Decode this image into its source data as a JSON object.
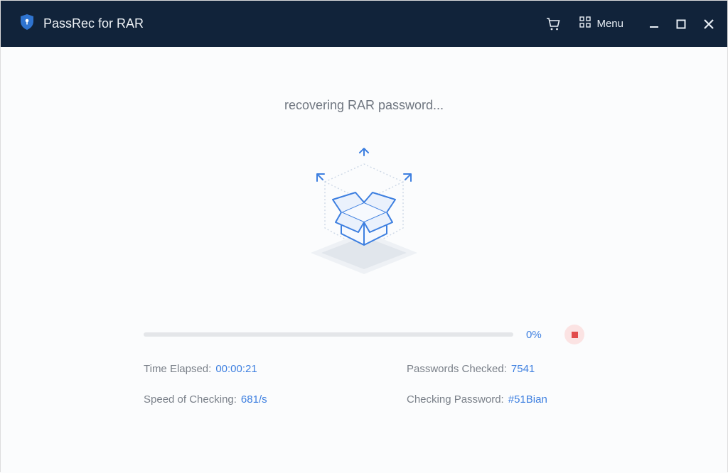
{
  "app": {
    "title": "PassRec for RAR",
    "menu_label": "Menu"
  },
  "status": {
    "text": "recovering RAR password..."
  },
  "progress": {
    "percent_label": "0%",
    "percent_value": 0
  },
  "stats": {
    "time_elapsed_label": "Time Elapsed:",
    "time_elapsed_value": "00:00:21",
    "passwords_checked_label": "Passwords Checked:",
    "passwords_checked_value": "7541",
    "speed_label": "Speed of Checking:",
    "speed_value": "681/s",
    "checking_password_label": "Checking Password:",
    "checking_password_value": "#51Bian"
  },
  "colors": {
    "accent": "#3d7fe0",
    "titlebar": "#11233a",
    "stop_bg": "#fbe3e3",
    "stop_fg": "#e24b4b"
  }
}
